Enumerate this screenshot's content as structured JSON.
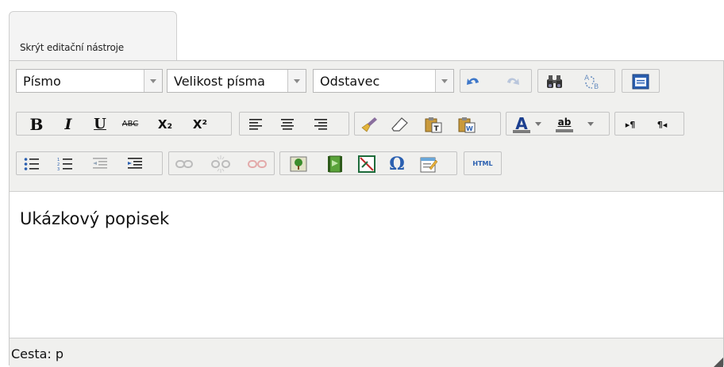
{
  "tab": {
    "label": "Skrýt editační nástroje"
  },
  "toolbar": {
    "font_select": "Písmo",
    "size_select": "Velikost písma",
    "format_select": "Odstavec",
    "bold": "B",
    "italic": "I",
    "underline": "U",
    "strike": "ABC",
    "sub": "X₂",
    "sup": "X²",
    "html": "HTML",
    "omega": "Ω",
    "textcolor_letter": "A",
    "highlight_letter": "ab",
    "ltr": "▸¶",
    "rtl": "¶◂"
  },
  "content": {
    "text": "Ukázkový popisek"
  },
  "status": {
    "path": "Cesta: p"
  },
  "colors": {
    "accent_blue": "#2a5fb0",
    "undo_blue": "#3d77c9",
    "toolbar_bg": "#f0f0ee"
  }
}
